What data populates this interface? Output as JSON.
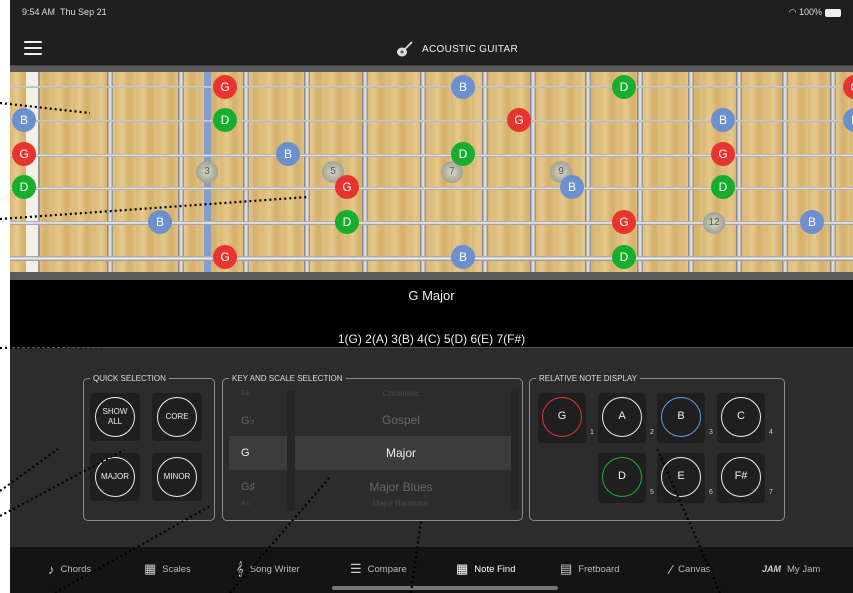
{
  "status_bar": {
    "time": "9:54 AM",
    "date": "Thu Sep 21",
    "battery": "100%"
  },
  "nav": {
    "title": "ACOUSTIC GUITAR",
    "menu_icon": "hamburger-menu-icon",
    "logo_icon": "guitar-icon"
  },
  "fretboard": {
    "notes": [
      {
        "label": "G"
      },
      {
        "label": "B"
      },
      {
        "label": "D"
      },
      {
        "label": "B"
      },
      {
        "label": "D"
      },
      {
        "label": "G"
      },
      {
        "label": "B"
      },
      {
        "label": "G"
      },
      {
        "label": "B"
      },
      {
        "label": "D"
      },
      {
        "label": "G"
      },
      {
        "label": "D"
      },
      {
        "label": "G"
      },
      {
        "label": "B"
      },
      {
        "label": "D"
      },
      {
        "label": "B"
      },
      {
        "label": "D"
      },
      {
        "label": "G"
      },
      {
        "label": "B"
      },
      {
        "label": "G"
      },
      {
        "label": "B"
      },
      {
        "label": "D"
      },
      {
        "label": "G"
      },
      {
        "label": "B"
      }
    ],
    "inlays": [
      "3",
      "5",
      "7",
      "9",
      "12"
    ],
    "colors": {
      "G": "#e8342e",
      "D": "#17ad2d",
      "B": "#6c90cf"
    }
  },
  "scale_info": {
    "name": "G Major",
    "notes": "1(G)  2(A)  3(B)  4(C)  5(D)  6(E)  7(F#)"
  },
  "quick_selection": {
    "legend": "QUICK SELECTION",
    "show_all": "SHOW ALL",
    "core": "CORE",
    "major": "MAJOR",
    "minor": "MINOR"
  },
  "key_scale": {
    "legend": "KEY AND SCALE SELECTION",
    "rows": [
      {
        "key": "F#",
        "scale": "Chromatic"
      },
      {
        "key": "G♭",
        "scale": "Gospel"
      },
      {
        "key": "G",
        "scale": "Major"
      },
      {
        "key": "G♯",
        "scale": "Major Blues"
      },
      {
        "key": "A♭",
        "scale": "Major Harmonic"
      }
    ]
  },
  "relative_notes": {
    "legend": "RELATIVE NOTE DISPLAY",
    "items": [
      {
        "note": "G",
        "degree": "1",
        "ring": "#d93b36"
      },
      {
        "note": "A",
        "degree": "2",
        "ring": "#eeeeee"
      },
      {
        "note": "B",
        "degree": "3",
        "ring": "#5aa0e8"
      },
      {
        "note": "C",
        "degree": "4",
        "ring": "#eeeeee"
      },
      {
        "note": "D",
        "degree": "5",
        "ring": "#20b030"
      },
      {
        "note": "E",
        "degree": "6",
        "ring": "#eeeeee"
      },
      {
        "note": "F#",
        "degree": "7",
        "ring": "#eeeeee"
      }
    ]
  },
  "tabs": [
    {
      "label": "Chords",
      "icon": "guitar-body-icon"
    },
    {
      "label": "Scales",
      "icon": "grid-icon"
    },
    {
      "label": "Song Writer",
      "icon": "clef-icon"
    },
    {
      "label": "Compare",
      "icon": "compare-icon"
    },
    {
      "label": "Note Find",
      "icon": "note-grid-icon"
    },
    {
      "label": "Fretboard",
      "icon": "fretboard-icon"
    },
    {
      "label": "Canvas",
      "icon": "brush-icon"
    },
    {
      "label": "My Jam",
      "icon": "jam-icon",
      "prefix": "JAM"
    }
  ],
  "active_tab": "Note Find"
}
